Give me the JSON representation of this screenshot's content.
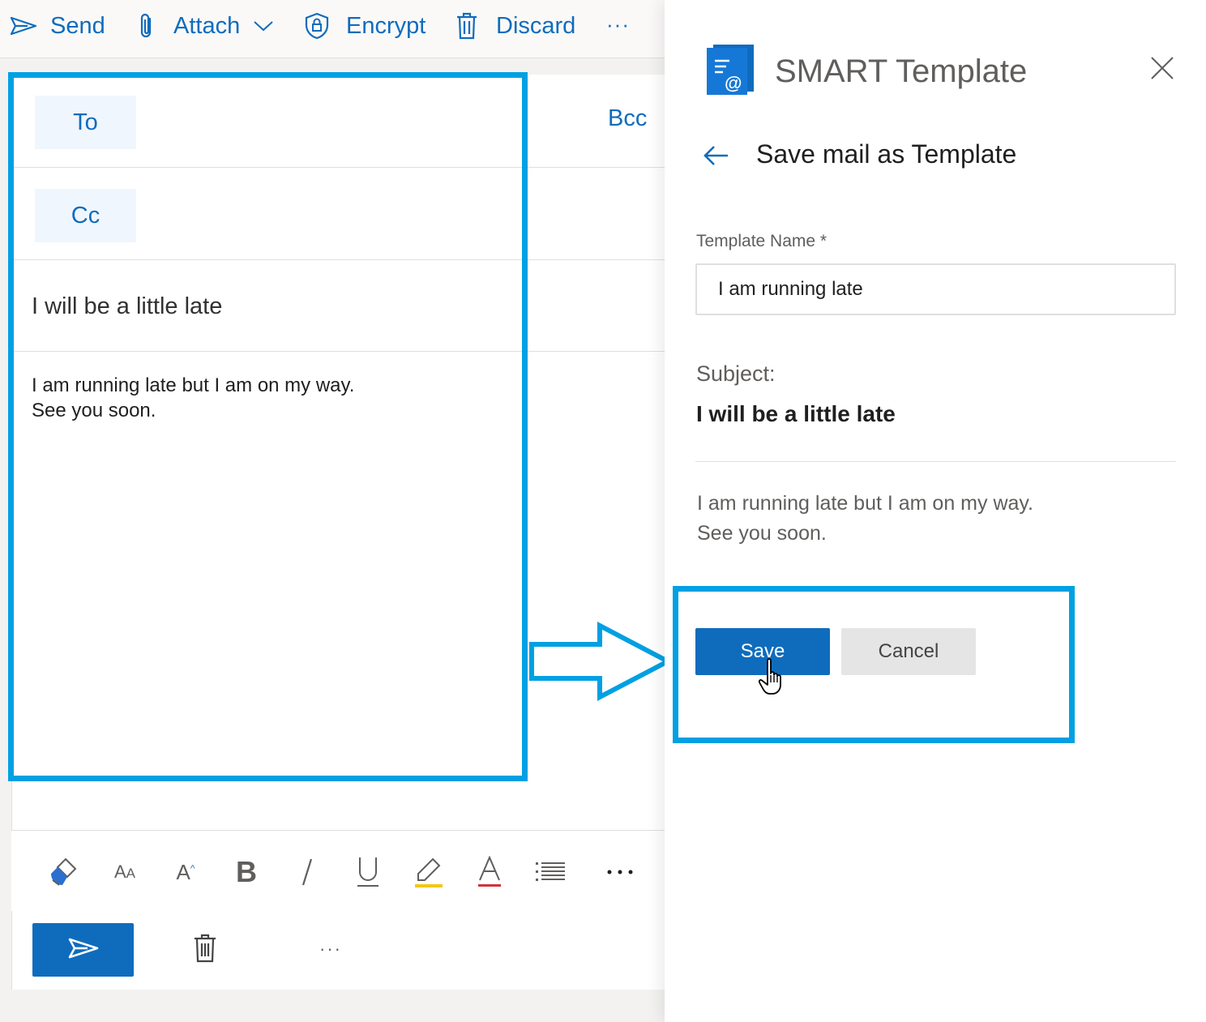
{
  "colors": {
    "accent": "#0f6cbd",
    "highlight": "#00a0e3",
    "secondary_button": "#e5e5e5"
  },
  "compose": {
    "toolbar": {
      "send_label": "Send",
      "attach_label": "Attach",
      "encrypt_label": "Encrypt",
      "discard_label": "Discard",
      "more_label": "···"
    },
    "to_label": "To",
    "cc_label": "Cc",
    "bcc_label": "Bcc",
    "subject": "I will be a little late",
    "body_lines": [
      "I am running late but I am on my way.",
      "See you soon."
    ],
    "format_icons": [
      "format-painter-icon",
      "font-size-icon",
      "grow-font-icon",
      "bold-icon",
      "italic-icon",
      "underline-icon",
      "highlight-icon",
      "font-color-icon",
      "bullets-icon",
      "more-icon"
    ],
    "bottom_more_label": "···"
  },
  "panel": {
    "title": "SMART Template",
    "section_title": "Save mail as Template",
    "template_name_label": "Template Name *",
    "template_name_value": "I am running late",
    "subject_label": "Subject:",
    "subject_value": "I will be a little late",
    "body_lines": [
      "I am running late but I am on my way.",
      "See you soon."
    ],
    "save_label": "Save",
    "cancel_label": "Cancel"
  }
}
